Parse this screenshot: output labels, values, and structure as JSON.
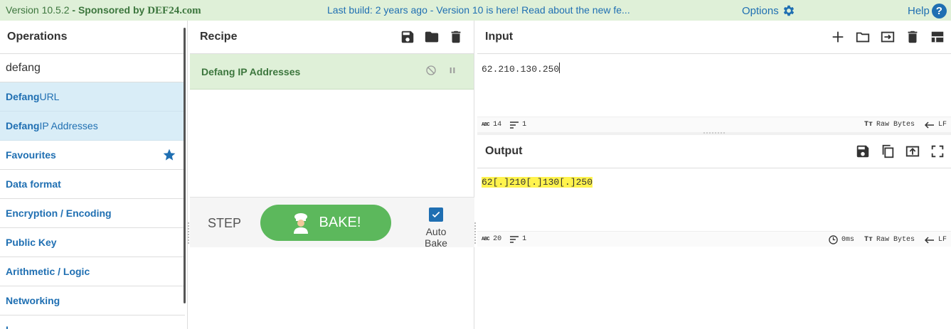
{
  "banner": {
    "version": "Version 10.5.2",
    "sponsored": " - Sponsored by ",
    "sponsor": "DEF24.com",
    "notice": "Last build: 2 years ago - Version 10 is here! Read about the new fe...",
    "options": "Options",
    "help": "Help"
  },
  "operations": {
    "title": "Operations",
    "search_value": "defang",
    "results": [
      {
        "match": "Defang",
        "rest": " URL"
      },
      {
        "match": "Defang",
        "rest": " IP Addresses"
      }
    ],
    "categories": [
      "Favourites",
      "Data format",
      "Encryption / Encoding",
      "Public Key",
      "Arithmetic / Logic",
      "Networking",
      "L"
    ]
  },
  "recipe": {
    "title": "Recipe",
    "operation": "Defang IP Addresses",
    "step": "STEP",
    "bake": "BAKE!",
    "autobake": "Auto Bake",
    "autobake_checked": true
  },
  "input": {
    "title": "Input",
    "value": "62.210.130.250",
    "length": "14",
    "lines": "1",
    "encoding": "Raw Bytes",
    "eol": "LF"
  },
  "output": {
    "title": "Output",
    "value": "62[.]210[.]130[.]250",
    "length": "20",
    "lines": "1",
    "time": "0ms",
    "encoding": "Raw Bytes",
    "eol": "LF"
  },
  "colors": {
    "accent": "#1f6fb2",
    "banner_bg": "#dff0d8",
    "bake": "#5cb85c",
    "highlight": "#fff34d"
  }
}
